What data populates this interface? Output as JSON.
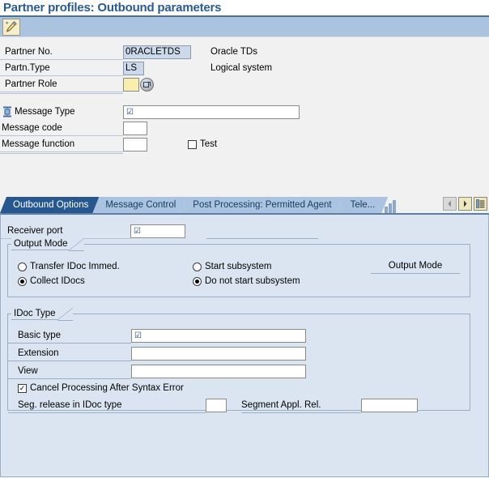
{
  "page_title": "Partner profiles: Outbound parameters",
  "colors": {
    "title_blue": "#2a5a96",
    "toolbar_blue": "#aac4e0",
    "active_tab": "#26588f",
    "inactive_tab": "#a9c3e0",
    "panel_bg": "#dbe5f1",
    "required_field": "#faeeac",
    "readonly_field": "#ccd9ea"
  },
  "toolbar": {
    "edit_button_icon": "pencil-icon",
    "edit_button_tooltip": "Display <-> Change"
  },
  "partner": {
    "partner_no_label": "Partner No.",
    "partner_no_value": "0RACLETDS",
    "partner_no_desc": "Oracle TDs",
    "partn_type_label": "Partn.Type",
    "partn_type_value": "LS",
    "partn_type_desc": "Logical system",
    "partner_role_label": "Partner Role",
    "partner_role_value": "",
    "partner_role_help_icon": "search-help-icon"
  },
  "message": {
    "type_icon": "hierarchy-node-icon",
    "message_type_label": "Message Type",
    "message_type_value": "",
    "message_code_label": "Message code",
    "message_code_value": "",
    "message_function_label": "Message function",
    "message_function_value": "",
    "test_label": "Test",
    "test_checked": false
  },
  "tabs": {
    "items": [
      {
        "label": "Outbound Options",
        "active": true
      },
      {
        "label": "Message Control",
        "active": false
      },
      {
        "label": "Post Processing: Permitted Agent",
        "active": false
      },
      {
        "label": "Tele...",
        "active": false
      }
    ],
    "nav": {
      "prev_icon": "chevron-left-icon",
      "prev_enabled": false,
      "next_icon": "chevron-right-icon",
      "next_enabled": true,
      "list_icon": "tab-list-icon"
    }
  },
  "outbound_options": {
    "receiver_port_label": "Receiver port",
    "receiver_port_value": "",
    "receiver_port_desc": "",
    "output_mode": {
      "group_label": "Output Mode",
      "side_text": "Output Mode",
      "options_left": [
        {
          "label": "Transfer IDoc Immed.",
          "selected": false
        },
        {
          "label": "Collect IDocs",
          "selected": true
        }
      ],
      "options_right": [
        {
          "label": "Start subsystem",
          "selected": false
        },
        {
          "label": "Do not start subsystem",
          "selected": true
        }
      ]
    },
    "idoc_type": {
      "group_label": "IDoc Type",
      "basic_type_label": "Basic type",
      "basic_type_value": "",
      "extension_label": "Extension",
      "extension_value": "",
      "view_label": "View",
      "view_value": "",
      "cancel_processing_label": "Cancel Processing After Syntax Error",
      "cancel_processing_checked": true,
      "seg_release_label": "Seg. release in IDoc type",
      "seg_release_value": "",
      "segment_appl_rel_label": "Segment Appl. Rel.",
      "segment_appl_rel_value": ""
    }
  }
}
